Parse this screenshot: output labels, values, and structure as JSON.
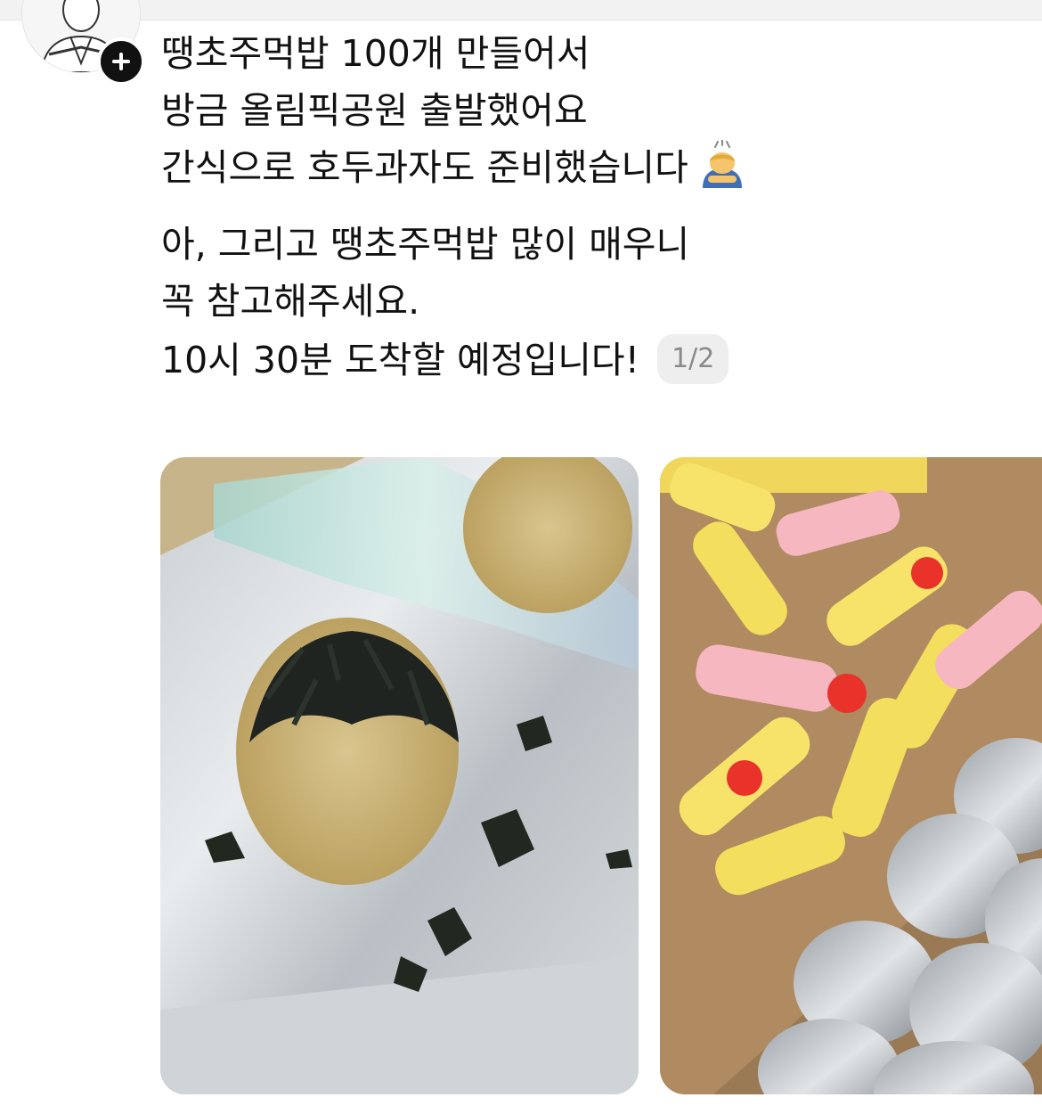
{
  "post": {
    "lines": [
      "땡초주먹밥 100개 만들어서",
      "방금 올림픽공원 출발했어요",
      "간식으로 호두과자도 준비했습니다",
      "아, 그리고 땡초주먹밥 많이 매우니",
      "꼭 참고해주세요.",
      "10시 30분 도착할 예정입니다!"
    ],
    "emoji": "person-bowing-emoji"
  },
  "media": {
    "pager": "1/2",
    "photos": [
      {
        "subject": "rice-ball-with-seaweed-on-foil"
      },
      {
        "subject": "box-of-snacks-and-foil-wrapped-rice-balls"
      }
    ]
  },
  "icons": {
    "follow": "plus-icon",
    "avatar": "avatar"
  },
  "colors": {
    "text": "#111111",
    "pager_bg": "#eeeeee",
    "pager_text": "#8a8a8a",
    "follow_bg": "#111111"
  }
}
